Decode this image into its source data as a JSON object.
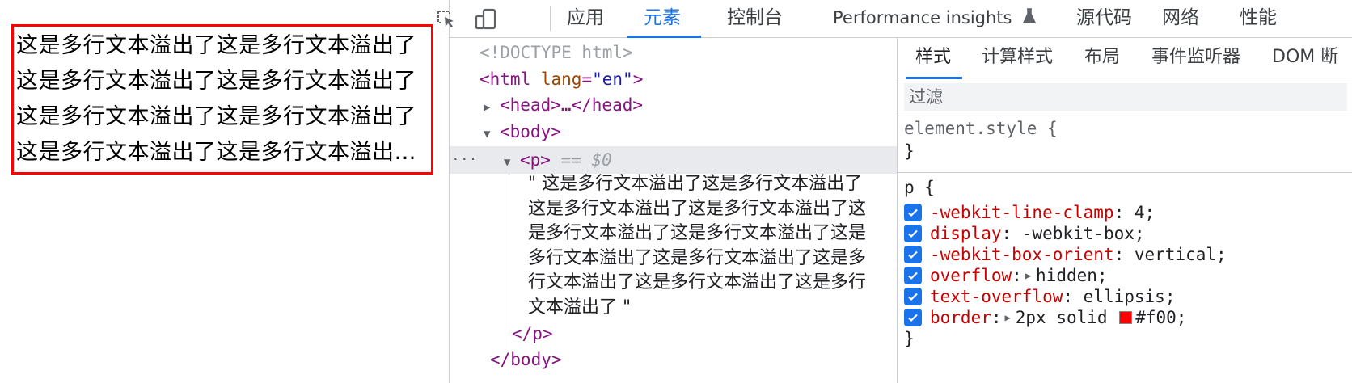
{
  "preview": {
    "paragraph_text": "这是多行文本溢出了这是多行文本溢出了这是多行文本溢出了这是多行文本溢出了这是多行文本溢出了这是多行文本溢出了这是多行文本溢出了这是多行文本溢出了这是多行文本溢出了这是多行文本溢出了这是多行文本溢出了",
    "border_color": "#f00"
  },
  "devtools": {
    "toolbar": {
      "inspect_icon": "select-element-icon",
      "device_icon": "device-toolbar-icon",
      "tabs": [
        {
          "label": "应用"
        },
        {
          "label": "元素"
        },
        {
          "label": "控制台"
        },
        {
          "label": "Performance insights"
        },
        {
          "label": "源代码"
        },
        {
          "label": "网络"
        },
        {
          "label": "性能"
        }
      ],
      "active_tab": "元素",
      "accent_color": "#1a73e8"
    },
    "elements": {
      "doctype": "<!DOCTYPE html>",
      "html_open": "<html",
      "html_attr_name": "lang",
      "html_attr_value": "\"en\"",
      "html_close_bracket": ">",
      "head_collapsed": "<head>…</head>",
      "body_open": "<body>",
      "p_open": "<p>",
      "selected_marker": "== $0",
      "row_menu": "···",
      "text_node": "\" 这是多行文本溢出了这是多行文本溢出了这是多行文本溢出了这是多行文本溢出了这是多行文本溢出了这是多行文本溢出了这是多行文本溢出了这是多行文本溢出了这是多行文本溢出了这是多行文本溢出了这是多行文本溢出了 \"",
      "p_close": "</p>",
      "body_close": "</body>"
    },
    "styles": {
      "sub_tabs": [
        {
          "label": "样式"
        },
        {
          "label": "计算样式"
        },
        {
          "label": "布局"
        },
        {
          "label": "事件监听器"
        },
        {
          "label": "DOM 断"
        }
      ],
      "active_sub_tab": "样式",
      "filter_placeholder": "过滤",
      "element_style_selector": "element.style {",
      "close_brace": "}",
      "p_rule_selector": "p {",
      "declarations": [
        {
          "name": "-webkit-line-clamp",
          "value": "4",
          "checked": true,
          "expandable": false
        },
        {
          "name": "display",
          "value": "-webkit-box",
          "checked": true,
          "expandable": false
        },
        {
          "name": "-webkit-box-orient",
          "value": "vertical",
          "checked": true,
          "expandable": false
        },
        {
          "name": "overflow",
          "value": "hidden",
          "checked": true,
          "expandable": true
        },
        {
          "name": "text-overflow",
          "value": "ellipsis",
          "checked": true,
          "expandable": false
        },
        {
          "name": "border",
          "value": "2px solid",
          "color_value": "#f00",
          "checked": true,
          "expandable": true
        }
      ]
    }
  }
}
